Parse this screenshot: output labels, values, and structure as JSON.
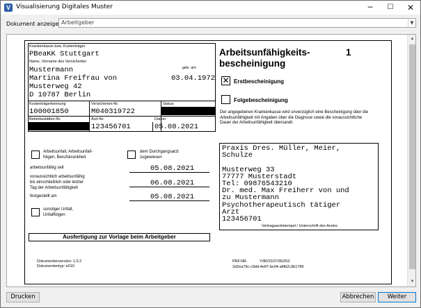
{
  "window": {
    "title": "Visualisierung Digitales Muster",
    "minimize": "─",
    "maximize": "☐",
    "close": "✕"
  },
  "selector": {
    "label": "Dokument anzeigen",
    "value": "Arbeitgeber"
  },
  "form": {
    "kasse_label": "Krankenkasse bzw. Kostenträger",
    "kasse_value": "PBeaKK Stuttgart",
    "name_label": "Name, Vorname des Versicherten",
    "geb_label": "geb. am",
    "lastname": "Mustermann",
    "firstname": "Martina Freifrau von",
    "birthdate": "03.04.1972",
    "street": "Musterweg 42",
    "city": "D 10787 Berlin",
    "kt_label": "Kostenträgerkennung",
    "kt_value": "100001850",
    "vnr_label": "Versicherten-Nr.",
    "vnr_value": "M040319722",
    "status_label": "Status",
    "bsnr_label": "Betriebsstätten-Nr.",
    "lanr_label": "Arzt-Nr.",
    "lanr_value": "123456701",
    "datum_label": "Datum",
    "datum_value": "05.08.2021",
    "title_line1": "Arbeitsunfähigkeits-",
    "title_line2": "bescheinigung",
    "page_number": "1",
    "erst_label": "Erstbescheinigung",
    "erst_mark": "✕",
    "folge_label": "Folgebescheinigung",
    "notice": "Der angegebenen Krankenkasse wird unverzüglich eine Bescheinigung über die Arbeitsunfähigkeit mit Angaben über die Diagnose sowie die voraussichtliche Dauer der Arbeitsunfähigkeit übersandt.",
    "unfall_label_1": "Arbeitsunfall, Arbeitsunfall-",
    "unfall_label_2": "folgen, Berufskrankheit",
    "durchgang_label_1": "dem Durchgangsarzt",
    "durchgang_label_2": "zugewiesen",
    "au_seit_label": "arbeitsunfähig seit",
    "au_seit_value": "05.08.2021",
    "au_bis_label_1": "voraussichtlich arbeitsunfähig",
    "au_bis_label_2": "bis einschließlich oder letzter",
    "au_bis_label_3": "Tag der Arbeitsunfähigkeit",
    "au_bis_value": "06.08.2021",
    "festgestellt_label": "festgestellt am",
    "festgestellt_value": "05.08.2021",
    "sonstiger_label_1": "sonstiger Unfall,",
    "sonstiger_label_2": "Unfallfolgen",
    "stamp_lines": [
      "Praxis Dres. Müller, Meier,",
      "Schulze",
      "",
      "Musterweg  33",
      "77777 Musterstadt",
      "Tel: 09876543210",
      "Dr. med. Max Freiherr von und",
      "zu Mustermann",
      "Psychotherapeutisch tätiger",
      "Arzt",
      "123456701"
    ],
    "stamp_caption": "Vertragsarztstempel / Unterschrift des Arztes",
    "ausfertigung": "Ausfertigung zur Vorlage beim Arbeitgeber",
    "docversion": "Dokumentenversion: 1.0.2",
    "doctype": "Dokumententyp: e010",
    "prf_label": "PRF.NR.",
    "prf_value": "Y/80/2107/36/253",
    "guid": "2d2ea79c-c9dd-4e87-bc04-af4b2c3b1789"
  },
  "buttons": {
    "print": "Drucken",
    "cancel": "Abbrechen",
    "next": "Weiter"
  },
  "icons": {
    "app": "app-logo-icon",
    "dropdown": "chevron-down-icon"
  }
}
